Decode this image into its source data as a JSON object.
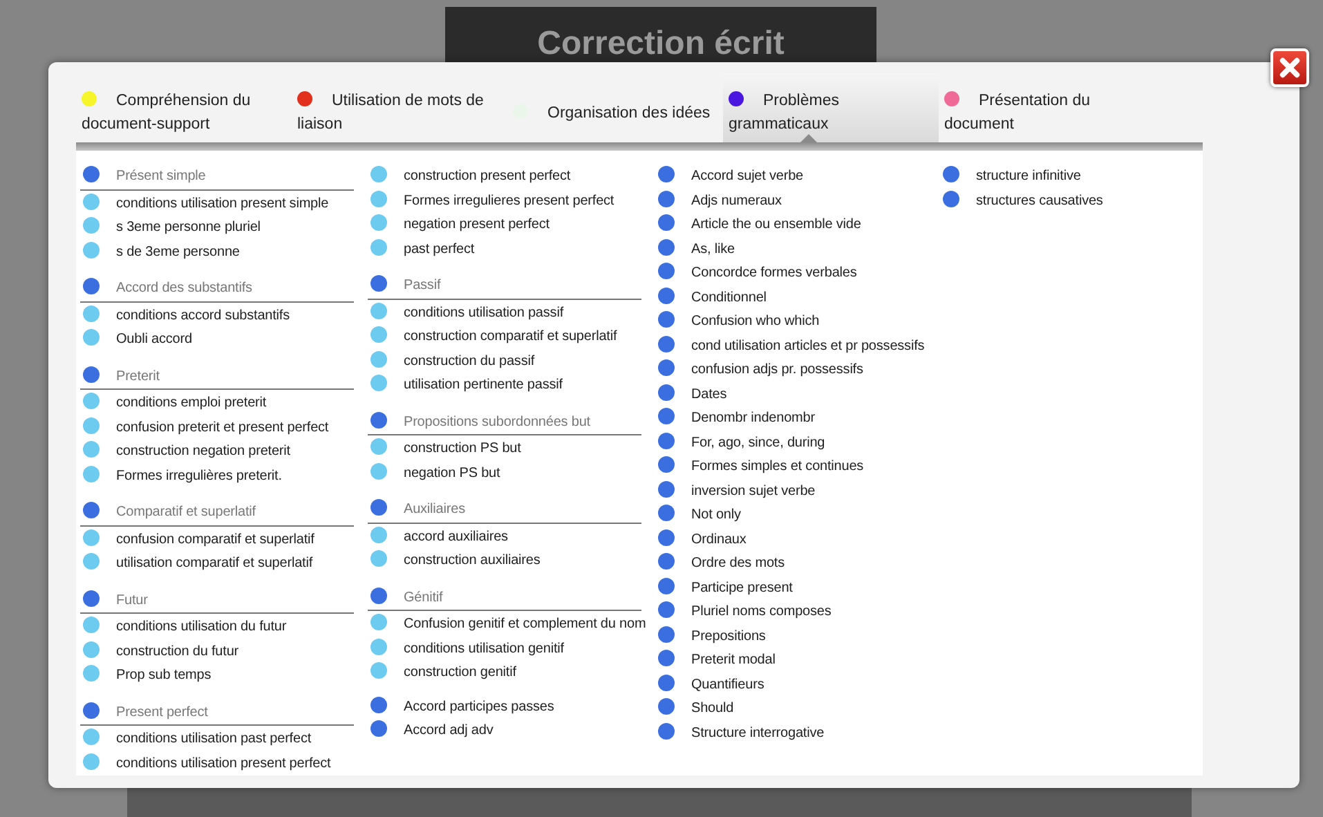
{
  "page": {
    "title": "Correction écrit"
  },
  "tabs": [
    {
      "label": "Compréhension du document-support",
      "color": "#f5f52a",
      "selected": false
    },
    {
      "label": "Utilisation de mots de liaison",
      "color": "#e2301c",
      "selected": false
    },
    {
      "label": "Organisation des idées",
      "color": "#eaf6ea",
      "selected": false
    },
    {
      "label": "Problèmes grammaticaux",
      "color": "#4a17e0",
      "selected": true
    },
    {
      "label": "Présentation du document",
      "color": "#f06a98",
      "selected": false
    }
  ],
  "columns": [
    [
      {
        "kind": "heading",
        "text": "Présent simple"
      },
      {
        "kind": "sub",
        "text": "conditions utilisation present simple"
      },
      {
        "kind": "sub",
        "text": "s 3eme personne pluriel"
      },
      {
        "kind": "sub",
        "text": "s de 3eme personne"
      },
      {
        "kind": "heading",
        "text": "Accord des substantifs"
      },
      {
        "kind": "sub",
        "text": "conditions accord substantifs"
      },
      {
        "kind": "sub",
        "text": "Oubli accord"
      },
      {
        "kind": "heading",
        "text": "Preterit"
      },
      {
        "kind": "sub",
        "text": "conditions emploi preterit"
      },
      {
        "kind": "sub",
        "text": "confusion preterit et present perfect"
      },
      {
        "kind": "sub",
        "text": "construction negation preterit"
      },
      {
        "kind": "sub",
        "text": "Formes irregulières preterit."
      },
      {
        "kind": "heading",
        "text": "Comparatif et superlatif"
      },
      {
        "kind": "sub",
        "text": "confusion comparatif et superlatif"
      },
      {
        "kind": "sub",
        "text": "utilisation comparatif et superlatif"
      },
      {
        "kind": "heading",
        "text": "Futur"
      },
      {
        "kind": "sub",
        "text": "conditions utilisation du futur"
      },
      {
        "kind": "sub",
        "text": "construction du futur"
      },
      {
        "kind": "sub",
        "text": "Prop sub temps"
      },
      {
        "kind": "heading",
        "text": "Present perfect"
      },
      {
        "kind": "sub",
        "text": "conditions utilisation past perfect"
      },
      {
        "kind": "sub",
        "text": "conditions utilisation present perfect"
      }
    ],
    [
      {
        "kind": "sub",
        "text": "construction present perfect"
      },
      {
        "kind": "sub",
        "text": "Formes irregulieres present perfect"
      },
      {
        "kind": "sub",
        "text": "negation present perfect"
      },
      {
        "kind": "sub",
        "text": "past perfect"
      },
      {
        "kind": "heading",
        "text": "Passif"
      },
      {
        "kind": "sub",
        "text": "conditions utilisation passif"
      },
      {
        "kind": "sub",
        "text": "construction comparatif et superlatif"
      },
      {
        "kind": "sub",
        "text": "construction du passif"
      },
      {
        "kind": "sub",
        "text": "utilisation pertinente passif"
      },
      {
        "kind": "heading",
        "text": "Propositions subordonnées but"
      },
      {
        "kind": "sub",
        "text": "construction PS but"
      },
      {
        "kind": "sub",
        "text": "negation PS but"
      },
      {
        "kind": "heading",
        "text": "Auxiliaires"
      },
      {
        "kind": "sub",
        "text": "accord auxiliaires"
      },
      {
        "kind": "sub",
        "text": "construction auxiliaires"
      },
      {
        "kind": "heading",
        "text": "Génitif"
      },
      {
        "kind": "sub",
        "text": "Confusion genitif et complement du nom"
      },
      {
        "kind": "sub",
        "text": "conditions utilisation genitif"
      },
      {
        "kind": "sub",
        "text": "construction genitif"
      },
      {
        "kind": "item",
        "text": "Accord participes passes",
        "gap": true
      },
      {
        "kind": "item",
        "text": "Accord adj adv"
      }
    ],
    [
      {
        "kind": "item",
        "text": "Accord sujet verbe"
      },
      {
        "kind": "item",
        "text": "Adjs numeraux"
      },
      {
        "kind": "item",
        "text": "Article the ou ensemble vide"
      },
      {
        "kind": "item",
        "text": "As, like"
      },
      {
        "kind": "item",
        "text": "Concordce formes verbales"
      },
      {
        "kind": "item",
        "text": "Conditionnel"
      },
      {
        "kind": "item",
        "text": "Confusion who which"
      },
      {
        "kind": "item",
        "text": "cond utilisation articles et pr possessifs"
      },
      {
        "kind": "item",
        "text": "confusion adjs pr. possessifs"
      },
      {
        "kind": "item",
        "text": "Dates"
      },
      {
        "kind": "item",
        "text": "Denombr indenombr"
      },
      {
        "kind": "item",
        "text": "For, ago, since, during"
      },
      {
        "kind": "item",
        "text": "Formes simples et continues"
      },
      {
        "kind": "item",
        "text": "inversion sujet verbe"
      },
      {
        "kind": "item",
        "text": "Not only"
      },
      {
        "kind": "item",
        "text": "Ordinaux"
      },
      {
        "kind": "item",
        "text": "Ordre des mots"
      },
      {
        "kind": "item",
        "text": "Participe present"
      },
      {
        "kind": "item",
        "text": "Pluriel noms composes"
      },
      {
        "kind": "item",
        "text": "Prepositions"
      },
      {
        "kind": "item",
        "text": "Preterit modal"
      },
      {
        "kind": "item",
        "text": "Quantifieurs"
      },
      {
        "kind": "item",
        "text": "Should"
      },
      {
        "kind": "item",
        "text": "Structure interrogative"
      }
    ],
    [
      {
        "kind": "item",
        "text": "structure infinitive"
      },
      {
        "kind": "item",
        "text": "structures causatives"
      }
    ]
  ]
}
